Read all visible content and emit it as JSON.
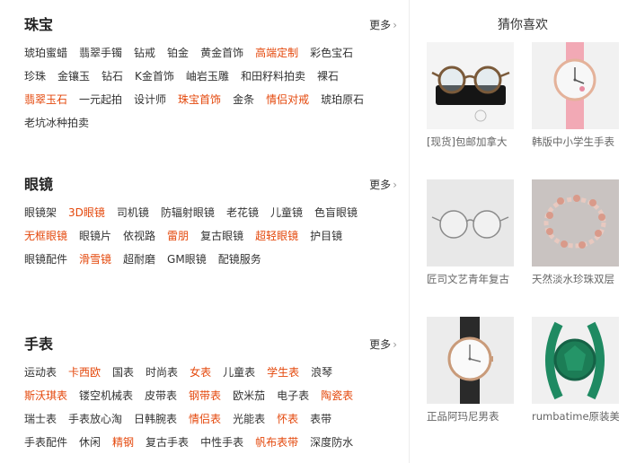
{
  "sections": [
    {
      "title": "珠宝",
      "more": "更多",
      "rows": [
        [
          {
            "t": "琥珀蜜蜡"
          },
          {
            "t": "翡翠手镯"
          },
          {
            "t": "钻戒"
          },
          {
            "t": "铂金"
          },
          {
            "t": "黄金首饰"
          },
          {
            "t": "高端定制",
            "hl": true
          },
          {
            "t": "彩色宝石"
          }
        ],
        [
          {
            "t": "珍珠"
          },
          {
            "t": "金镶玉"
          },
          {
            "t": "钻石"
          },
          {
            "t": "K金首饰"
          },
          {
            "t": "岫岩玉雕"
          },
          {
            "t": "和田籽料拍卖"
          },
          {
            "t": "裸石"
          }
        ],
        [
          {
            "t": "翡翠玉石",
            "hl": true
          },
          {
            "t": "一元起拍"
          },
          {
            "t": "设计师"
          },
          {
            "t": "珠宝首饰",
            "hl": true
          },
          {
            "t": "金条"
          },
          {
            "t": "情侣对戒",
            "hl": true
          },
          {
            "t": "琥珀原石"
          }
        ],
        [
          {
            "t": "老坑冰种拍卖"
          }
        ]
      ]
    },
    {
      "title": "眼镜",
      "more": "更多",
      "rows": [
        [
          {
            "t": "眼镜架"
          },
          {
            "t": "3D眼镜",
            "hl": true
          },
          {
            "t": "司机镜"
          },
          {
            "t": "防辐射眼镜"
          },
          {
            "t": "老花镜"
          },
          {
            "t": "儿童镜"
          },
          {
            "t": "色盲眼镜"
          }
        ],
        [
          {
            "t": "无框眼镜",
            "hl": true
          },
          {
            "t": "眼镜片"
          },
          {
            "t": "依视路"
          },
          {
            "t": "雷朋",
            "hl": true
          },
          {
            "t": "复古眼镜"
          },
          {
            "t": "超轻眼镜",
            "hl": true
          },
          {
            "t": "护目镜"
          }
        ],
        [
          {
            "t": "眼镜配件"
          },
          {
            "t": "滑雪镜",
            "hl": true
          },
          {
            "t": "超耐磨"
          },
          {
            "t": "GM眼镜"
          },
          {
            "t": "配镜服务"
          }
        ]
      ]
    },
    {
      "title": "手表",
      "more": "更多",
      "rows": [
        [
          {
            "t": "运动表"
          },
          {
            "t": "卡西欧",
            "hl": true
          },
          {
            "t": "国表"
          },
          {
            "t": "时尚表"
          },
          {
            "t": "女表",
            "hl": true
          },
          {
            "t": "儿童表"
          },
          {
            "t": "学生表",
            "hl": true
          },
          {
            "t": "浪琴"
          }
        ],
        [
          {
            "t": "斯沃琪表",
            "hl": true
          },
          {
            "t": "镂空机械表"
          },
          {
            "t": "皮带表"
          },
          {
            "t": "钢带表",
            "hl": true
          },
          {
            "t": "欧米茄"
          },
          {
            "t": "电子表"
          },
          {
            "t": "陶瓷表",
            "hl": true
          }
        ],
        [
          {
            "t": "瑞士表"
          },
          {
            "t": "手表放心淘"
          },
          {
            "t": "日韩腕表"
          },
          {
            "t": "情侣表",
            "hl": true
          },
          {
            "t": "光能表"
          },
          {
            "t": "怀表",
            "hl": true
          },
          {
            "t": "表带"
          }
        ],
        [
          {
            "t": "手表配件"
          },
          {
            "t": "休闲"
          },
          {
            "t": "精钢",
            "hl": true
          },
          {
            "t": "复古手表"
          },
          {
            "t": "中性手表"
          },
          {
            "t": "帆布表带",
            "hl": true
          },
          {
            "t": "深度防水"
          }
        ]
      ]
    }
  ],
  "recommend": {
    "title": "猜你喜欢",
    "items": [
      {
        "caption": "[现货]包邮加拿大",
        "icon": "glasses-image"
      },
      {
        "caption": "韩版中小学生手表",
        "icon": "pink-watch-image"
      },
      {
        "caption": "匠司文艺青年复古",
        "icon": "eyeglasses-image"
      },
      {
        "caption": "天然淡水珍珠双层",
        "icon": "pearl-bracelet-image"
      },
      {
        "caption": "正品阿玛尼男表",
        "icon": "armani-watch-image"
      },
      {
        "caption": "rumbatime原装美",
        "icon": "green-watch-image"
      }
    ]
  },
  "colors": {
    "highlight": "#e4480c",
    "text": "#333333",
    "title": "#222222"
  }
}
